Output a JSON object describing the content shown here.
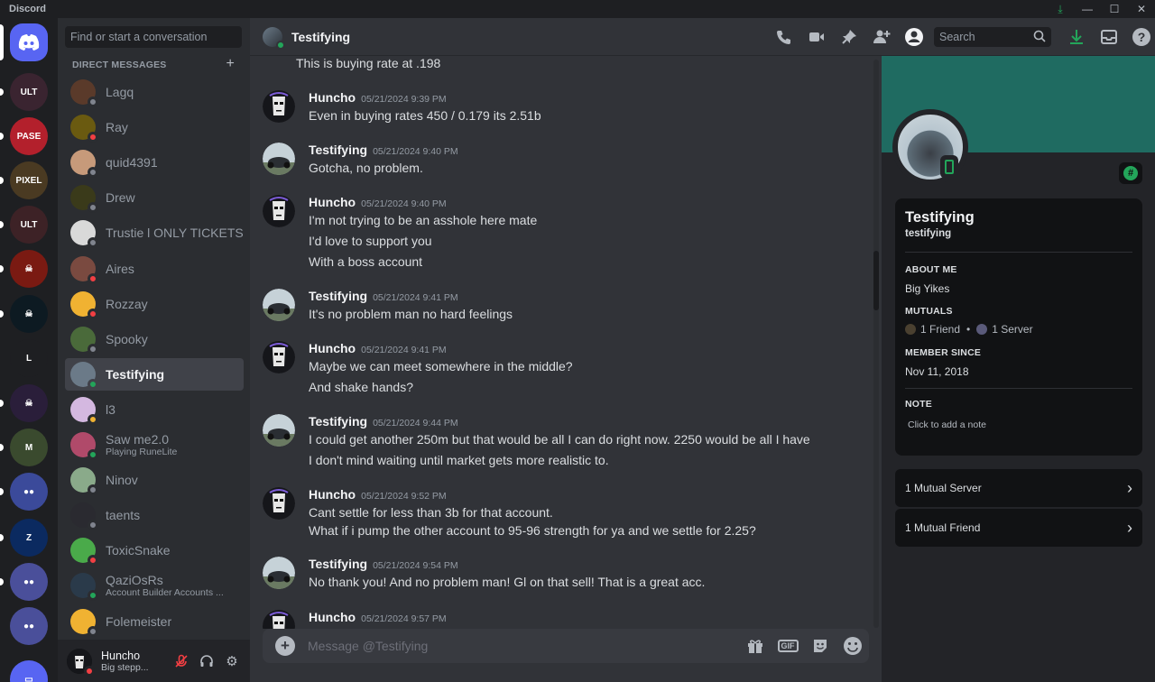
{
  "titlebar": {
    "app_name": "Discord"
  },
  "guilds": [
    {
      "label": "DC",
      "color": "#5865f2"
    },
    {
      "label": "ULT",
      "color": "#3a2430"
    },
    {
      "label": "PASE",
      "color": "#b3202c"
    },
    {
      "label": "PIXEL",
      "color": "#4a3a22"
    },
    {
      "label": "ULT",
      "color": "#3d2226"
    },
    {
      "label": "☠",
      "color": "#7a1a12"
    },
    {
      "label": "☠",
      "color": "#0d1a22"
    },
    {
      "label": "L",
      "color": "#1e1f22"
    },
    {
      "label": "☠",
      "color": "#2a1e3a"
    },
    {
      "label": "M",
      "color": "#3a4a2e"
    },
    {
      "label": "●●",
      "color": "#3b4a9a"
    },
    {
      "label": "Z",
      "color": "#0b2a60"
    },
    {
      "label": "●●",
      "color": "#4a4f9a"
    },
    {
      "label": "●●",
      "color": "#4a4f9a"
    },
    {
      "label": "▭",
      "color": "#5865f2"
    }
  ],
  "dm": {
    "search_placeholder": "Find or start a conversation",
    "header": "DIRECT MESSAGES",
    "items": [
      {
        "name": "Lagq",
        "sub": "",
        "status": "offline",
        "color": "#5a3a2a"
      },
      {
        "name": "Ray",
        "sub": "",
        "status": "dnd",
        "color": "#6a5a10"
      },
      {
        "name": "quid4391",
        "sub": "",
        "status": "offline",
        "color": "#c79a7a"
      },
      {
        "name": "Drew",
        "sub": "",
        "status": "offline",
        "color": "#3a3a1a"
      },
      {
        "name": "Trustie l ONLY TICKETS",
        "sub": "",
        "status": "offline",
        "color": "#d9d9d9"
      },
      {
        "name": "Aires",
        "sub": "",
        "status": "dnd",
        "color": "#7a4a40"
      },
      {
        "name": "Rozzay",
        "sub": "",
        "status": "dnd",
        "color": "#f0b232"
      },
      {
        "name": "Spooky",
        "sub": "",
        "status": "offline",
        "color": "#4a6a3a"
      },
      {
        "name": "Testifying",
        "sub": "",
        "status": "online",
        "color": "#6b7a88"
      },
      {
        "name": "l3",
        "sub": "",
        "status": "idle",
        "color": "#d4b8e0"
      },
      {
        "name": "Saw me2.0",
        "sub": "Playing RuneLite",
        "status": "online",
        "color": "#b04a6a"
      },
      {
        "name": "Ninov",
        "sub": "",
        "status": "offline",
        "color": "#8aaa8a"
      },
      {
        "name": "taents",
        "sub": "",
        "status": "offline",
        "color": "#2a2a30"
      },
      {
        "name": "ToxicSnake",
        "sub": "",
        "status": "dnd",
        "color": "#4aaa4a"
      },
      {
        "name": "QaziOsRs",
        "sub": "Account Builder Accounts ...",
        "status": "online",
        "color": "#2a3a4a"
      },
      {
        "name": "Folemeister",
        "sub": "",
        "status": "offline",
        "color": "#f0b232"
      }
    ]
  },
  "user": {
    "name": "Huncho",
    "status": "Big stepp..."
  },
  "chat": {
    "title": "Testifying",
    "search_placeholder": "Search",
    "composer_placeholder": "Message @Testifying",
    "first_line": "This is buying rate at .198",
    "groups": [
      {
        "author": "Huncho",
        "time": "05/21/2024 9:39 PM",
        "lines": [
          "Even in buying rates 450 / 0.179 its 2.51b"
        ]
      },
      {
        "author": "Testifying",
        "time": "05/21/2024 9:40 PM",
        "lines": [
          "Gotcha, no problem."
        ]
      },
      {
        "author": "Huncho",
        "time": "05/21/2024 9:40 PM",
        "lines": [
          "I'm not trying to be an asshole here mate",
          "I'd love to support you",
          "With a boss account"
        ]
      },
      {
        "author": "Testifying",
        "time": "05/21/2024 9:41 PM",
        "lines": [
          "It's no problem man no hard feelings"
        ]
      },
      {
        "author": "Huncho",
        "time": "05/21/2024 9:41 PM",
        "lines": [
          "Maybe we can meet somewhere in the middle?",
          "And shake hands?"
        ]
      },
      {
        "author": "Testifying",
        "time": "05/21/2024 9:44 PM",
        "lines": [
          "I could get another 250m but that would be all I can do right now. 2250 would be all I have",
          "I don't mind waiting until market gets more realistic to."
        ]
      },
      {
        "author": "Huncho",
        "time": "05/21/2024 9:52 PM",
        "lines": [
          "Cant settle for less than 3b for that account.",
          "What if i pump the other account to 95-96 strength for ya and we settle for 2.25?"
        ]
      },
      {
        "author": "Testifying",
        "time": "05/21/2024 9:54 PM",
        "lines": [
          "No thank you! And no problem man! Gl on that sell! That is a great acc."
        ]
      },
      {
        "author": "Huncho",
        "time": "05/21/2024 9:57 PM",
        "lines": []
      }
    ]
  },
  "profile": {
    "display_name": "Testifying",
    "username": "testifying",
    "about_label": "ABOUT ME",
    "about_text": "Big Yikes",
    "mutuals_label": "MUTUALS",
    "mutual_friends": "1 Friend",
    "mutual_servers": "1 Server",
    "member_label": "MEMBER SINCE",
    "member_since": "Nov 11, 2018",
    "note_label": "NOTE",
    "note_placeholder": "Click to add a note",
    "mutual_server_link": "1 Mutual Server",
    "mutual_friend_link": "1 Mutual Friend",
    "banner_color": "#1f6b61"
  }
}
